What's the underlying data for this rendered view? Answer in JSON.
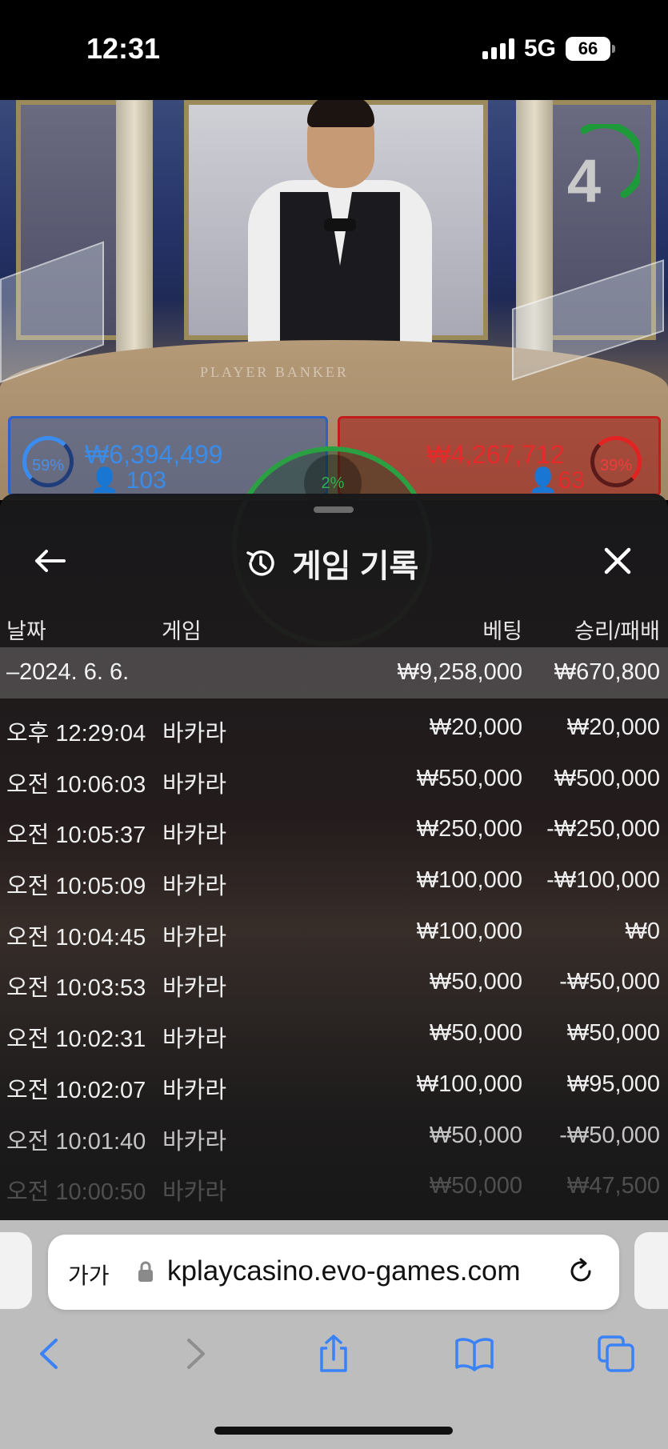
{
  "status_bar": {
    "time": "12:31",
    "network": "5G",
    "battery": "66"
  },
  "live_game": {
    "timer": "4",
    "table_text": "PLAYER     BANKER",
    "player": {
      "percent": "59%",
      "amount": "₩6,394,499",
      "count": "103",
      "color": "#3a8ce8"
    },
    "banker": {
      "percent": "39%",
      "amount": "₩4,267,712",
      "count": "63",
      "color": "#e62a2a"
    },
    "tie": {
      "percent": "2%",
      "color": "#32b04c"
    }
  },
  "history": {
    "title": "게임 기록",
    "columns": {
      "date": "날짜",
      "game": "게임",
      "bet": "베팅",
      "win_loss": "승리/패배"
    },
    "date_group": {
      "label": "–2024. 6. 6.",
      "bet": "₩9,258,000",
      "win_loss": "₩670,800"
    },
    "rows": [
      {
        "time": "오후 12:29:04",
        "game": "바카라",
        "bet": "₩20,000",
        "win_loss": "₩20,000"
      },
      {
        "time": "오전 10:06:03",
        "game": "바카라",
        "bet": "₩550,000",
        "win_loss": "₩500,000"
      },
      {
        "time": "오전 10:05:37",
        "game": "바카라",
        "bet": "₩250,000",
        "win_loss": "-₩250,000"
      },
      {
        "time": "오전 10:05:09",
        "game": "바카라",
        "bet": "₩100,000",
        "win_loss": "-₩100,000"
      },
      {
        "time": "오전 10:04:45",
        "game": "바카라",
        "bet": "₩100,000",
        "win_loss": "₩0"
      },
      {
        "time": "오전 10:03:53",
        "game": "바카라",
        "bet": "₩50,000",
        "win_loss": "-₩50,000"
      },
      {
        "time": "오전 10:02:31",
        "game": "바카라",
        "bet": "₩50,000",
        "win_loss": "₩50,000"
      },
      {
        "time": "오전 10:02:07",
        "game": "바카라",
        "bet": "₩100,000",
        "win_loss": "₩95,000"
      },
      {
        "time": "오전 10:01:40",
        "game": "바카라",
        "bet": "₩50,000",
        "win_loss": "-₩50,000"
      },
      {
        "time": "오전 10:00:50",
        "game": "바카라",
        "bet": "₩50,000",
        "win_loss": "₩47,500"
      }
    ]
  },
  "browser": {
    "text_size": "가가",
    "url": "kplaycasino.evo-games.com",
    "accent": "#3a82f7"
  }
}
